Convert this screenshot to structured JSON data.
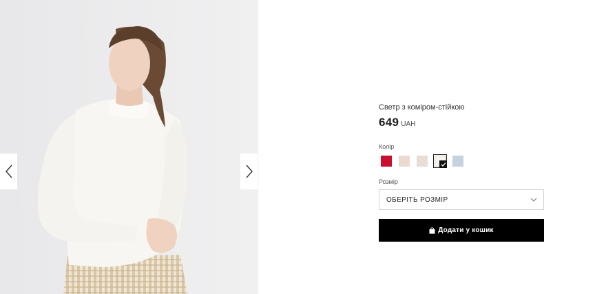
{
  "product": {
    "name": "Светр з коміром-стійкою",
    "price": "649",
    "currency": "UAH"
  },
  "gallery": {
    "image_icon": "model-photo",
    "prev_icon": "chevron-left-icon",
    "next_icon": "chevron-right-icon"
  },
  "color": {
    "label": "Колір",
    "swatches": [
      {
        "name": "red",
        "color": "#c8102e",
        "selected": false
      },
      {
        "name": "pink-beige",
        "color": "#ecd9d2",
        "selected": false
      },
      {
        "name": "light-beige-pattern",
        "color": "#ede4dd",
        "selected": false
      },
      {
        "name": "cream",
        "color": "#f5f3ee",
        "selected": true
      },
      {
        "name": "light-blue",
        "color": "#c6d3df",
        "selected": false
      }
    ]
  },
  "size": {
    "label": "Розмір",
    "placeholder": "ОБЕРІТЬ РОЗМІР"
  },
  "cart": {
    "add_label": "Додати у кошик",
    "icon": "shopping-bag-icon"
  },
  "colors": {
    "button_bg": "#000000",
    "gallery_bg": "#ececed"
  }
}
